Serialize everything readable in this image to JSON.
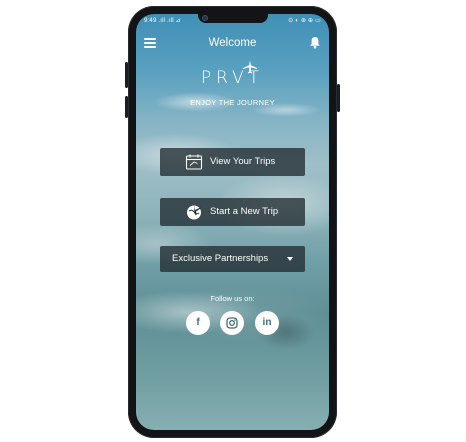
{
  "status_bar": {
    "left": "9:49 .ıll .ıll ⊿",
    "right": "⊙ ◐ ⊛ ⊕ ▭"
  },
  "app_bar": {
    "title": "Welcome",
    "menu_icon": "hamburger-menu-icon",
    "notification_icon": "bell-icon"
  },
  "brand": {
    "logo_text": "PRVT",
    "tagline": "ENJOY THE JOURNEY"
  },
  "actions": {
    "view_trips": {
      "label": "View Your Trips",
      "icon": "calendar-icon"
    },
    "new_trip": {
      "label": "Start a New Trip",
      "icon": "globe-plane-icon"
    },
    "partnerships": {
      "label": "Exclusive Partnerships",
      "icon": "caret-down-icon"
    }
  },
  "social": {
    "heading": "Follow us on:",
    "items": [
      {
        "name": "facebook",
        "glyph": "f"
      },
      {
        "name": "instagram",
        "glyph": ""
      },
      {
        "name": "linkedin",
        "glyph": "in"
      }
    ]
  },
  "colors": {
    "button_bg": "#232d32",
    "social_icon": "#3f6f76",
    "text": "#ffffff"
  }
}
